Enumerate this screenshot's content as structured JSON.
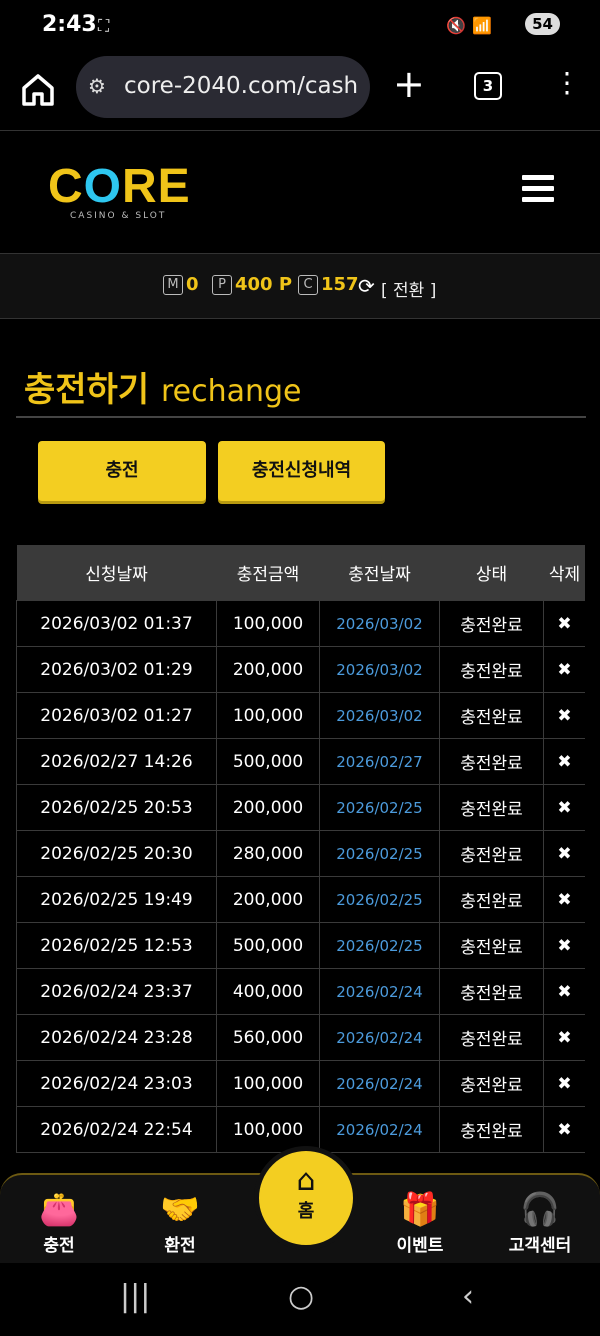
{
  "status": {
    "time": "2:43",
    "battery": "54"
  },
  "browser": {
    "url": "core-2040.com/cash",
    "tab_count": "3"
  },
  "site": {
    "logo_word_pre": "C",
    "logo_word_o": "O",
    "logo_word_post": "RE",
    "logo_sub": "CASINO & SLOT"
  },
  "balance": {
    "m_icon": "M",
    "m_value": "0",
    "p_icon": "P",
    "p_value": "400 P",
    "c_icon": "C",
    "c_value": "157",
    "switch_label": "[ 전환 ]"
  },
  "page": {
    "title_ko": "충전하기",
    "title_en": "rechange"
  },
  "tabs": {
    "charge_label": "충전",
    "history_label": "충전신청내역"
  },
  "table": {
    "headers": [
      "신청날짜",
      "충전금액",
      "충전날짜",
      "상태",
      "삭제"
    ],
    "rows": [
      {
        "req": "2026/03/02 01:37",
        "amount": "100,000",
        "date": "2026/03/02",
        "status": "충전완료",
        "del": "✖"
      },
      {
        "req": "2026/03/02 01:29",
        "amount": "200,000",
        "date": "2026/03/02",
        "status": "충전완료",
        "del": "✖"
      },
      {
        "req": "2026/03/02 01:27",
        "amount": "100,000",
        "date": "2026/03/02",
        "status": "충전완료",
        "del": "✖"
      },
      {
        "req": "2026/02/27 14:26",
        "amount": "500,000",
        "date": "2026/02/27",
        "status": "충전완료",
        "del": "✖"
      },
      {
        "req": "2026/02/25 20:53",
        "amount": "200,000",
        "date": "2026/02/25",
        "status": "충전완료",
        "del": "✖"
      },
      {
        "req": "2026/02/25 20:30",
        "amount": "280,000",
        "date": "2026/02/25",
        "status": "충전완료",
        "del": "✖"
      },
      {
        "req": "2026/02/25 19:49",
        "amount": "200,000",
        "date": "2026/02/25",
        "status": "충전완료",
        "del": "✖"
      },
      {
        "req": "2026/02/25 12:53",
        "amount": "500,000",
        "date": "2026/02/25",
        "status": "충전완료",
        "del": "✖"
      },
      {
        "req": "2026/02/24 23:37",
        "amount": "400,000",
        "date": "2026/02/24",
        "status": "충전완료",
        "del": "✖"
      },
      {
        "req": "2026/02/24 23:28",
        "amount": "560,000",
        "date": "2026/02/24",
        "status": "충전완료",
        "del": "✖"
      },
      {
        "req": "2026/02/24 23:03",
        "amount": "100,000",
        "date": "2026/02/24",
        "status": "충전완료",
        "del": "✖"
      },
      {
        "req": "2026/02/24 22:54",
        "amount": "100,000",
        "date": "2026/02/24",
        "status": "충전완료",
        "del": "✖"
      }
    ]
  },
  "bottomnav": {
    "charge": "충전",
    "exchange": "환전",
    "home": "홈",
    "event": "이벤트",
    "support": "고객센터"
  },
  "colors": {
    "accent": "#f3ce21",
    "link": "#4c9bdc",
    "background": "#000000"
  }
}
